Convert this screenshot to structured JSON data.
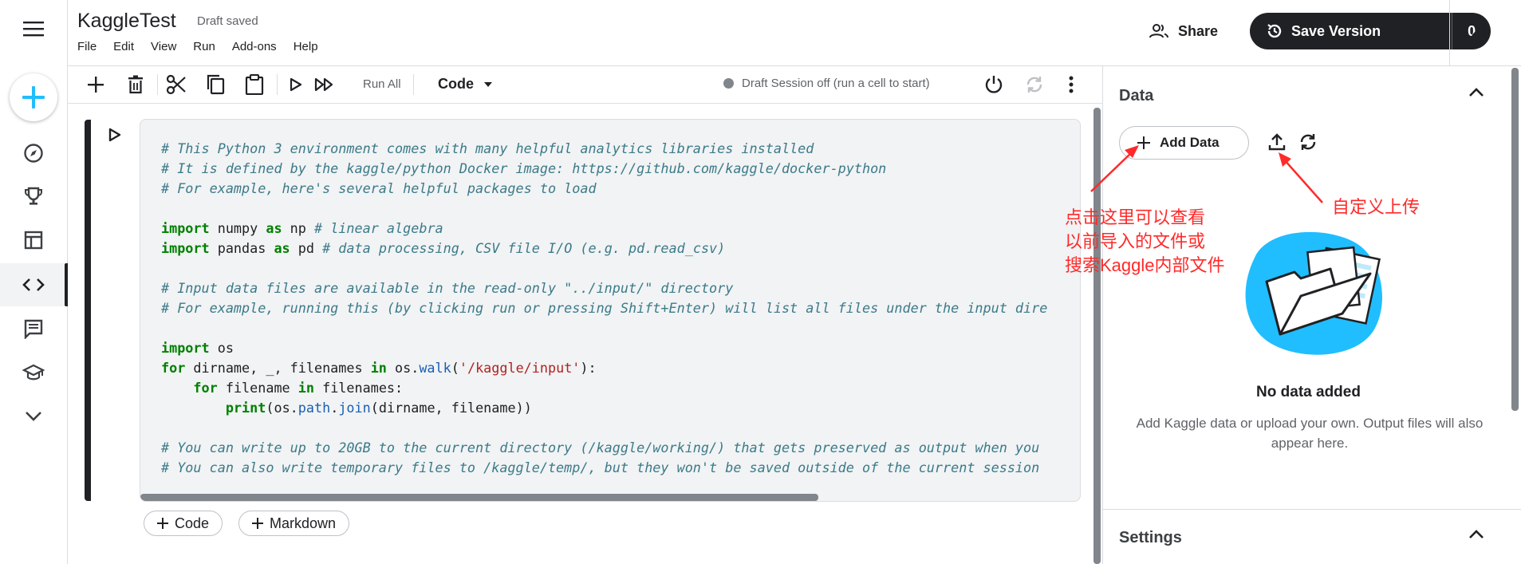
{
  "header": {
    "title": "KaggleTest",
    "draft_status": "Draft saved",
    "menu": [
      "File",
      "Edit",
      "View",
      "Run",
      "Add-ons",
      "Help"
    ],
    "share_label": "Share",
    "save_version_label": "Save Version",
    "version_count": "0"
  },
  "toolbar": {
    "run_all_label": "Run All",
    "cell_type": "Code",
    "session_status": "Draft Session off (run a cell to start)"
  },
  "cell": {
    "code_lines": [
      "# This Python 3 environment comes with many helpful analytics libraries installed",
      "# It is defined by the kaggle/python Docker image: https://github.com/kaggle/docker-python",
      "# For example, here's several helpful packages to load",
      "",
      "import numpy as np # linear algebra",
      "import pandas as pd # data processing, CSV file I/O (e.g. pd.read_csv)",
      "",
      "# Input data files are available in the read-only \"../input/\" directory",
      "# For example, running this (by clicking run or pressing Shift+Enter) will list all files under the input dire",
      "",
      "import os",
      "for dirname, _, filenames in os.walk('/kaggle/input'):",
      "    for filename in filenames:",
      "        print(os.path.join(dirname, filename))",
      "",
      "# You can write up to 20GB to the current directory (/kaggle/working/) that gets preserved as output when you",
      "# You can also write temporary files to /kaggle/temp/, but they won't be saved outside of the current session"
    ]
  },
  "add_cell": {
    "code_label": "Code",
    "markdown_label": "Markdown"
  },
  "right_panel": {
    "data_title": "Data",
    "add_data_label": "Add Data",
    "empty_title": "No data added",
    "empty_description": "Add Kaggle data or upload your own. Output files will also appear here.",
    "settings_title": "Settings"
  },
  "annotations": {
    "add_data_note": [
      "点击这里可以查看",
      "以前导入的文件或",
      "搜索Kaggle内部文件"
    ],
    "upload_note": "自定义上传"
  },
  "icons": {
    "rail": [
      "menu-icon",
      "create-icon",
      "compass-icon",
      "trophy-icon",
      "table-icon",
      "code-icon",
      "comment-icon",
      "school-icon",
      "chevron-down-icon"
    ]
  },
  "colors": {
    "accent": "#20BEFF",
    "dark": "#202124",
    "annotation": "#FF2A2A"
  }
}
